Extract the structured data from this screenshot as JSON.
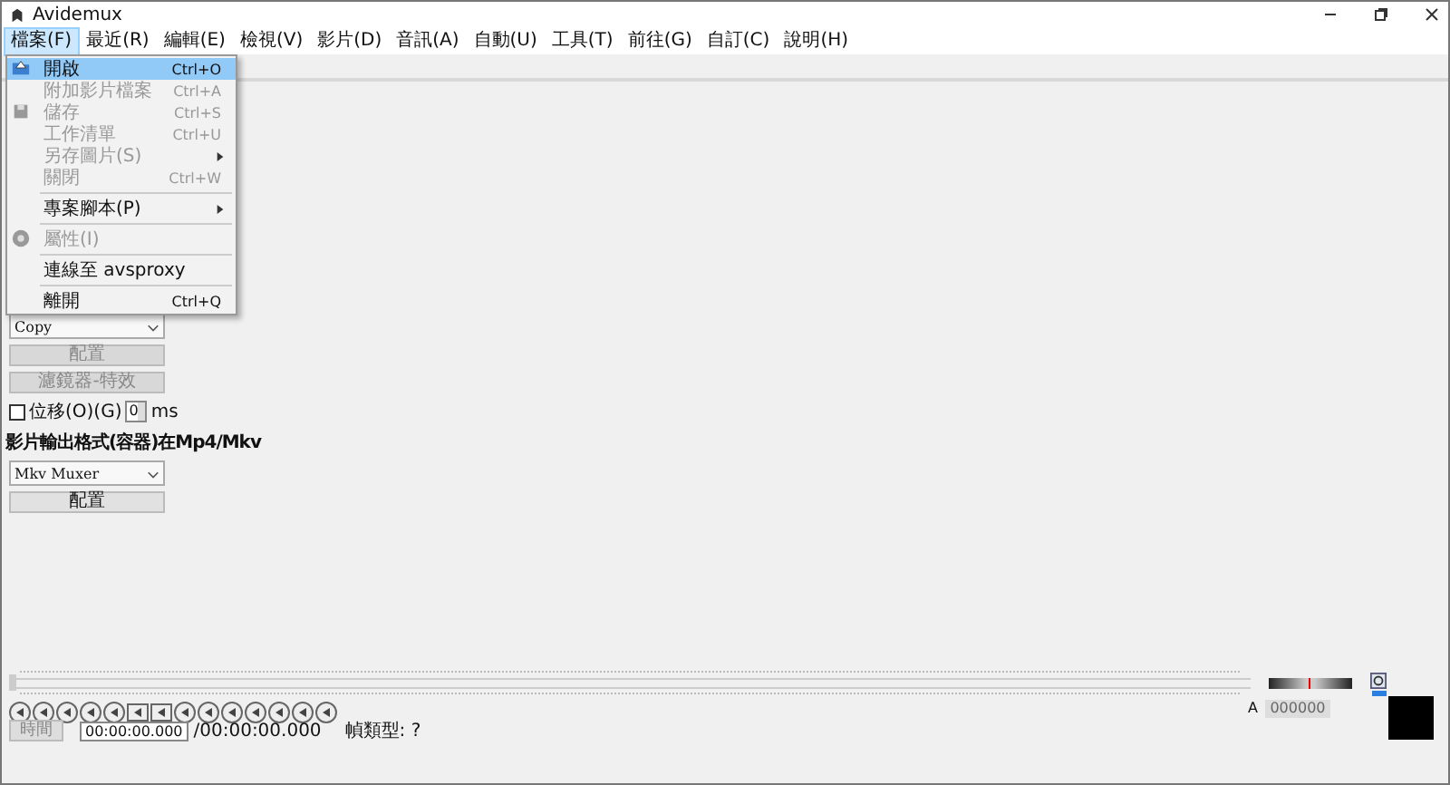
{
  "window": {
    "title": "Avidemux"
  },
  "menubar": [
    {
      "label": "檔案(F)",
      "selected": true
    },
    {
      "label": "最近(R)",
      "selected": false
    },
    {
      "label": "編輯(E)",
      "selected": false
    },
    {
      "label": "檢視(V)",
      "selected": false
    },
    {
      "label": "影片(D)",
      "selected": false
    },
    {
      "label": "音訊(A)",
      "selected": false
    },
    {
      "label": "自動(U)",
      "selected": false
    },
    {
      "label": "工具(T)",
      "selected": false
    },
    {
      "label": "前往(G)",
      "selected": false
    },
    {
      "label": "自訂(C)",
      "selected": false
    },
    {
      "label": "說明(H)",
      "selected": false
    }
  ],
  "file_menu": [
    {
      "kind": "item",
      "label": "開啟",
      "shortcut": "Ctrl+O",
      "disabled": false,
      "selected": true,
      "submenu": false
    },
    {
      "kind": "item",
      "label": "附加影片檔案",
      "shortcut": "Ctrl+A",
      "disabled": true,
      "selected": false,
      "submenu": false
    },
    {
      "kind": "item",
      "label": "儲存",
      "shortcut": "Ctrl+S",
      "disabled": true,
      "selected": false,
      "submenu": false
    },
    {
      "kind": "item",
      "label": "工作清單",
      "shortcut": "Ctrl+U",
      "disabled": true,
      "selected": false,
      "submenu": false
    },
    {
      "kind": "item",
      "label": "另存圖片(S)",
      "disabled": true,
      "selected": false,
      "submenu": true
    },
    {
      "kind": "item",
      "label": "關閉",
      "shortcut": "Ctrl+W",
      "disabled": true,
      "selected": false,
      "submenu": false
    },
    {
      "kind": "separator"
    },
    {
      "kind": "item",
      "label": "專案腳本(P)",
      "disabled": false,
      "selected": false,
      "submenu": true
    },
    {
      "kind": "separator"
    },
    {
      "kind": "item",
      "label": "屬性(I)",
      "disabled": true,
      "selected": false,
      "submenu": false
    },
    {
      "kind": "separator"
    },
    {
      "kind": "item",
      "label": "連線至 avsproxy",
      "disabled": false,
      "selected": false,
      "submenu": false
    },
    {
      "kind": "separator"
    },
    {
      "kind": "item",
      "label": "離開",
      "shortcut": "Ctrl+Q",
      "disabled": false,
      "selected": false,
      "submenu": false
    }
  ],
  "left_panel": {
    "audio_codec": "Copy",
    "audio_configure": {
      "label": "配置",
      "disabled": true
    },
    "audio_filters": {
      "label": "濾鏡器-特效",
      "disabled": true
    },
    "shift": {
      "label": "位移(O)(G)",
      "checked": false,
      "value": "0",
      "unit": "ms"
    },
    "output_format_label": "影片輸出格式(容器)在Mp4/Mkv",
    "muxer": "Mkv Muxer",
    "muxer_configure": {
      "label": "配置",
      "disabled": false
    }
  },
  "bottom": {
    "timeline": {
      "level": 0
    },
    "time_button": {
      "label": "時間",
      "disabled": true
    },
    "current_time": "00:00:00.000",
    "total_time": "/00:00:00.000",
    "frame_type": "幀類型: ?",
    "a_label": "A",
    "a_value": "000000"
  }
}
